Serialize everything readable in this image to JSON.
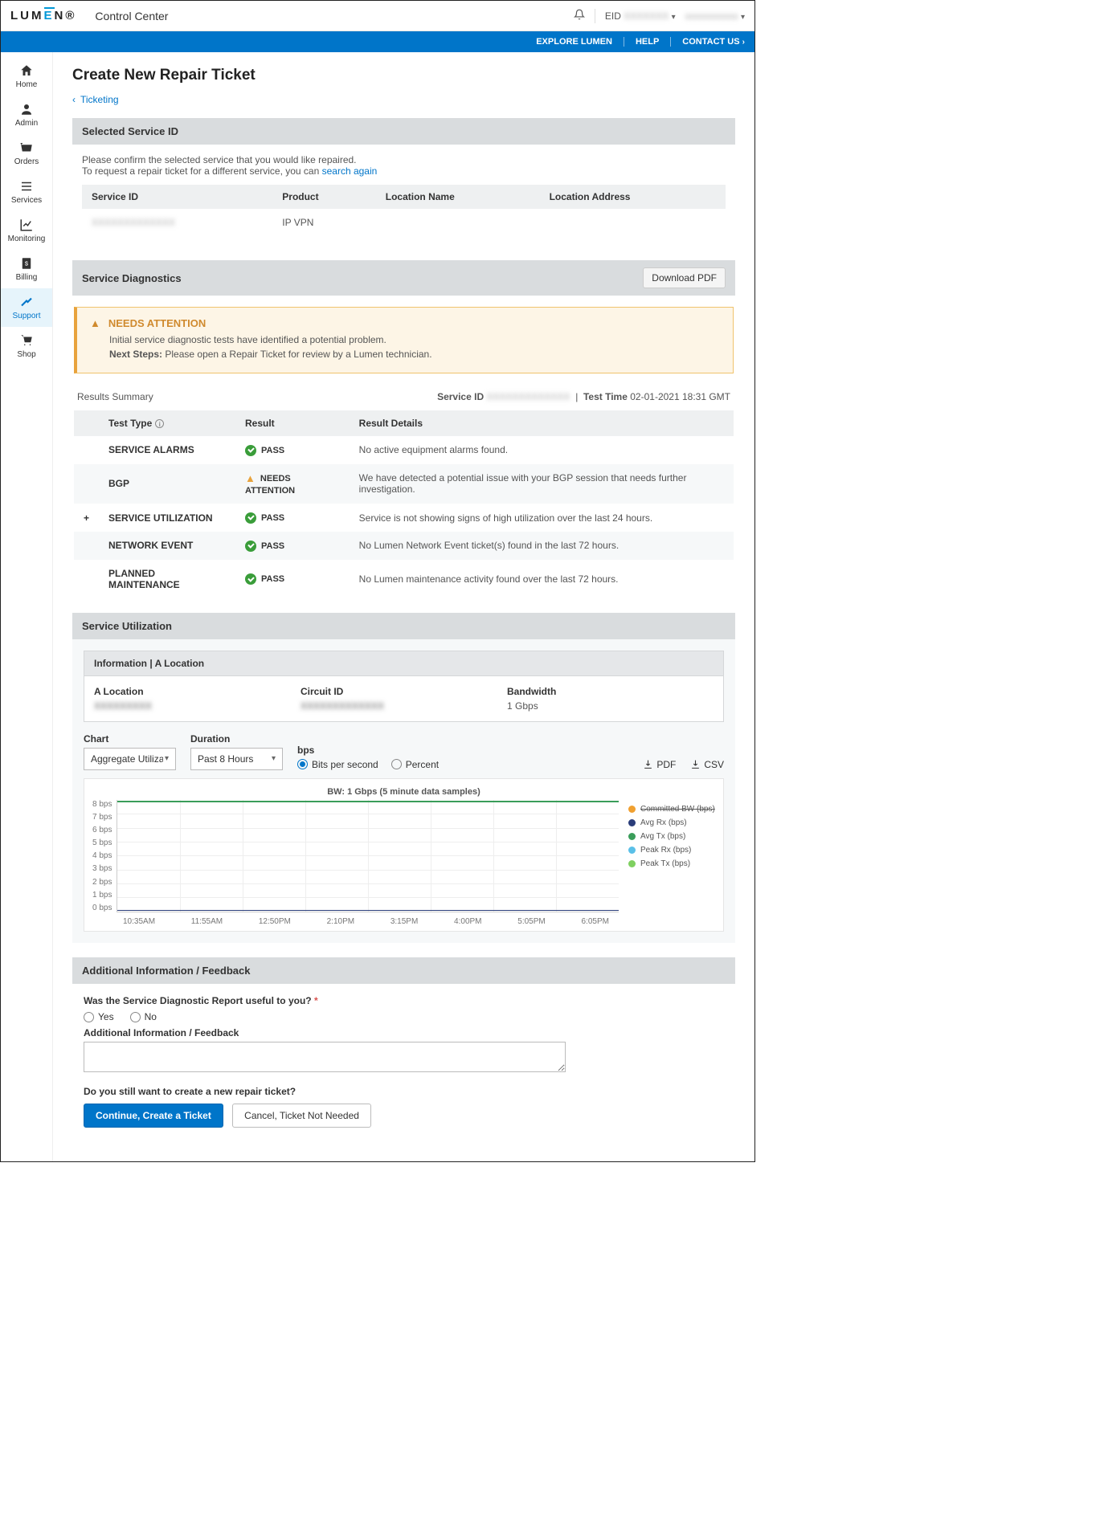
{
  "header": {
    "logo_text": "LUMEN",
    "app_title": "Control Center",
    "eid_label": "EID",
    "eid_value": "XXXXXXX",
    "user_value": "xxxxxxxxxxx"
  },
  "bluebar": {
    "explore": "EXPLORE LUMEN",
    "help": "HELP",
    "contact": "CONTACT US"
  },
  "sidenav": [
    {
      "id": "home",
      "label": "Home"
    },
    {
      "id": "admin",
      "label": "Admin"
    },
    {
      "id": "orders",
      "label": "Orders"
    },
    {
      "id": "services",
      "label": "Services"
    },
    {
      "id": "monitoring",
      "label": "Monitoring"
    },
    {
      "id": "billing",
      "label": "Billing"
    },
    {
      "id": "support",
      "label": "Support"
    },
    {
      "id": "shop",
      "label": "Shop"
    }
  ],
  "page_title": "Create New Repair Ticket",
  "breadcrumb": "Ticketing",
  "selected_service": {
    "head": "Selected Service ID",
    "line1": "Please confirm the selected service that you would like repaired.",
    "line2_a": "To request a repair ticket for a different service, you can ",
    "line2_link": "search again",
    "cols": {
      "service_id": "Service ID",
      "product": "Product",
      "location_name": "Location Name",
      "location_address": "Location Address"
    },
    "row": {
      "service_id": "XXXXXXXXXXXXX",
      "product": "IP VPN",
      "location_name": "",
      "location_address": ""
    }
  },
  "diagnostics": {
    "head": "Service Diagnostics",
    "download": "Download PDF",
    "alert_title": "NEEDS ATTENTION",
    "alert_p1": "Initial service diagnostic tests have identified a potential problem.",
    "alert_p2_label": "Next Steps:",
    "alert_p2_text": " Please open a Repair Ticket for review by a Lumen technician.",
    "results_label": "Results Summary",
    "service_id_label": "Service ID",
    "service_id_value": "XXXXXXXXXXXXX",
    "test_time_label": "Test Time",
    "test_time_value": "02-01-2021 18:31 GMT",
    "cols": {
      "test_type": "Test Type",
      "result": "Result",
      "details": "Result Details"
    },
    "rows": [
      {
        "exp": "",
        "type": "SERVICE ALARMS",
        "status": "pass",
        "result": "PASS",
        "details": "No active equipment alarms found."
      },
      {
        "exp": "",
        "type": "BGP",
        "status": "warn",
        "result": "NEEDS ATTENTION",
        "details": "We have detected a potential issue with your BGP session that needs further investigation."
      },
      {
        "exp": "+",
        "type": "SERVICE UTILIZATION",
        "status": "pass",
        "result": "PASS",
        "details": "Service is not showing signs of high utilization over the last 24 hours."
      },
      {
        "exp": "",
        "type": "NETWORK EVENT",
        "status": "pass",
        "result": "PASS",
        "details": "No Lumen Network Event ticket(s) found in the last 72 hours."
      },
      {
        "exp": "",
        "type": "PLANNED MAINTENANCE",
        "status": "pass",
        "result": "PASS",
        "details": "No Lumen maintenance activity found over the last 72 hours."
      }
    ]
  },
  "utilization": {
    "head": "Service Utilization",
    "info_head": "Information | A Location",
    "a_location_label": "A Location",
    "a_location_value": "XXXXXXXXX",
    "circuit_label": "Circuit ID",
    "circuit_value": "XXXXXXXXXXXXX",
    "bandwidth_label": "Bandwidth",
    "bandwidth_value": "1 Gbps",
    "chart_label": "Chart",
    "chart_select": "Aggregate Utilization",
    "duration_label": "Duration",
    "duration_select": "Past 8 Hours",
    "bps_label": "bps",
    "radio_bps": "Bits per second",
    "radio_pct": "Percent",
    "export_pdf": "PDF",
    "export_csv": "CSV",
    "chart_title": "BW: 1 Gbps    (5 minute data samples)",
    "legend": [
      {
        "label": "Committed BW (bps)",
        "color": "#f0a030",
        "strike": true
      },
      {
        "label": "Avg Rx (bps)",
        "color": "#2a3d7a"
      },
      {
        "label": "Avg Tx (bps)",
        "color": "#3a9d5a"
      },
      {
        "label": "Peak Rx (bps)",
        "color": "#5ac0e8"
      },
      {
        "label": "Peak Tx (bps)",
        "color": "#7fd060"
      }
    ]
  },
  "chart_data": {
    "type": "line",
    "title": "BW: 1 Gbps (5 minute data samples)",
    "xlabel": "",
    "ylabel": "bps",
    "ylim": [
      0,
      8
    ],
    "y_ticks": [
      "8 bps",
      "7 bps",
      "6 bps",
      "5 bps",
      "4 bps",
      "3 bps",
      "2 bps",
      "1 bps",
      "0 bps"
    ],
    "x_ticks": [
      "10:35AM",
      "11:55AM",
      "12:50PM",
      "2:10PM",
      "3:15PM",
      "4:00PM",
      "5:05PM",
      "6:05PM"
    ],
    "series": [
      {
        "name": "Avg Tx (bps)",
        "color": "#3a9d5a",
        "values": [
          8,
          8,
          8,
          8,
          8,
          8,
          8,
          8
        ]
      },
      {
        "name": "Avg Rx (bps)",
        "color": "#2a3d7a",
        "values": [
          0,
          0,
          0,
          0,
          0,
          0,
          0,
          0
        ]
      }
    ]
  },
  "feedback": {
    "head": "Additional Information / Feedback",
    "q1": "Was the Service Diagnostic Report useful to you?",
    "yes": "Yes",
    "no": "No",
    "extra_label": "Additional Information / Feedback",
    "q2": "Do you still want to create a new repair ticket?",
    "continue": "Continue, Create a Ticket",
    "cancel": "Cancel, Ticket Not Needed"
  }
}
